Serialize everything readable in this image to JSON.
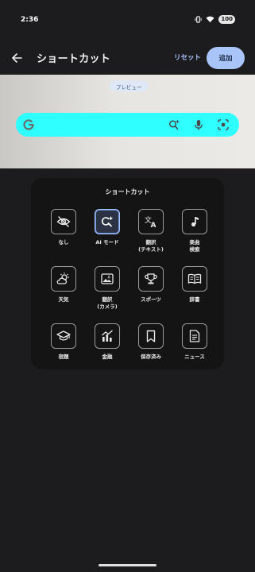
{
  "status_bar": {
    "time": "2:36",
    "battery": "100"
  },
  "app_bar": {
    "title": "ショートカット",
    "reset_label": "リセット",
    "add_label": "追加"
  },
  "preview": {
    "label": "プレビュー",
    "search_bar_color": "#2fffff"
  },
  "panel": {
    "title": "ショートカット",
    "selected": "AI モード",
    "tiles": [
      {
        "label": "なし",
        "icon": "eye-off-icon"
      },
      {
        "label": "AI モード",
        "icon": "ai-mode-search-icon"
      },
      {
        "label": "翻訳\n(テキスト)",
        "icon": "translate-icon"
      },
      {
        "label": "楽曲\n検索",
        "icon": "music-note-icon"
      },
      {
        "label": "天気",
        "icon": "weather-icon"
      },
      {
        "label": "翻訳\n(カメラ)",
        "icon": "camera-translate-icon"
      },
      {
        "label": "スポーツ",
        "icon": "trophy-icon"
      },
      {
        "label": "辞書",
        "icon": "dictionary-icon"
      },
      {
        "label": "宿題",
        "icon": "graduation-cap-icon"
      },
      {
        "label": "金融",
        "icon": "finance-chart-icon"
      },
      {
        "label": "保存済み",
        "icon": "bookmark-icon"
      },
      {
        "label": "ニュース",
        "icon": "news-icon"
      }
    ]
  },
  "colors": {
    "background": "#1c1c1e",
    "accent": "#a8c4f8",
    "panel": "#141414"
  }
}
